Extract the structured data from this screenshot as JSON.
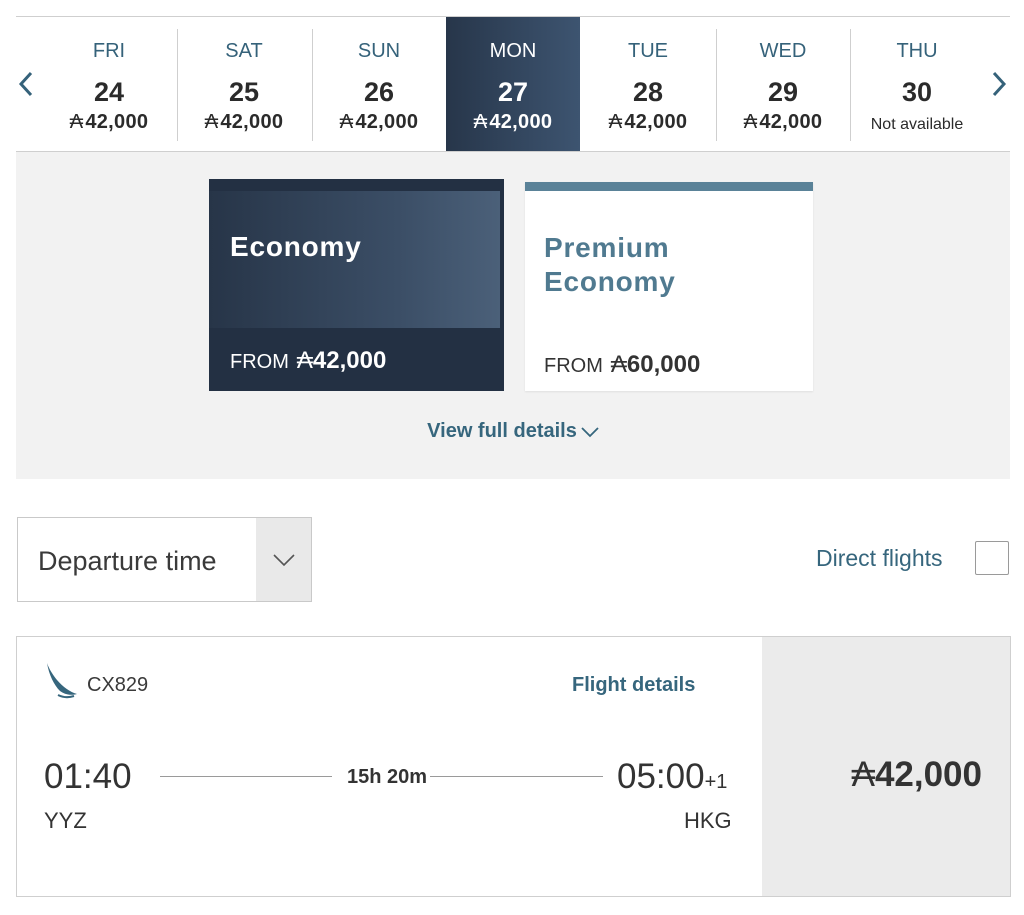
{
  "currency_symbol": "₳",
  "date_strip": {
    "prev_icon": "chevron-left-icon",
    "next_icon": "chevron-right-icon",
    "days": [
      {
        "dow": "FRI",
        "date": "24",
        "price": "42,000",
        "available": true
      },
      {
        "dow": "SAT",
        "date": "25",
        "price": "42,000",
        "available": true
      },
      {
        "dow": "SUN",
        "date": "26",
        "price": "42,000",
        "available": true
      },
      {
        "dow": "MON",
        "date": "27",
        "price": "42,000",
        "available": true,
        "selected": true
      },
      {
        "dow": "TUE",
        "date": "28",
        "price": "42,000",
        "available": true
      },
      {
        "dow": "WED",
        "date": "29",
        "price": "42,000",
        "available": true
      },
      {
        "dow": "THU",
        "date": "30",
        "price": "Not available",
        "available": false
      }
    ]
  },
  "cabins": {
    "economy": {
      "name": "Economy",
      "from_label": "FROM",
      "price": "42,000",
      "selected": true
    },
    "premium": {
      "name": "Premium Economy",
      "from_label": "FROM",
      "price": "60,000",
      "selected": false
    },
    "view_details": "View full details"
  },
  "filters": {
    "sort_value": "Departure time",
    "direct_label": "Direct flights",
    "direct_checked": false
  },
  "flight": {
    "airline_icon": "airline-logo-icon",
    "number": "CX829",
    "details_link": "Flight details",
    "dep_time": "01:40",
    "dep_code": "YYZ",
    "duration": "15h 20m",
    "arr_time": "05:00",
    "arr_day_offset": "+1",
    "arr_code": "HKG",
    "price": "42,000"
  },
  "colors": {
    "selected_dark": "#27364a",
    "accent_teal": "#36667d",
    "premium_bar": "#5a8298"
  }
}
